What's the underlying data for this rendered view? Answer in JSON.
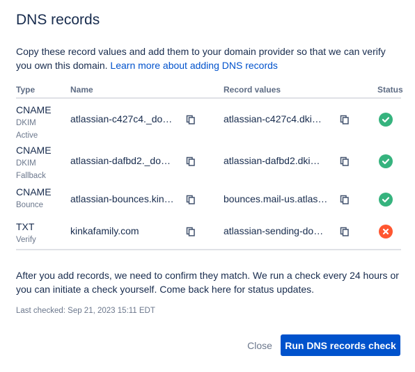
{
  "dialog": {
    "title": "DNS records",
    "intro_text": "Copy these record values and add them to your domain provider so that we can verify you own this domain.",
    "intro_link": "Learn more about adding DNS records"
  },
  "table": {
    "headers": {
      "type": "Type",
      "name": "Name",
      "values": "Record values",
      "status": "Status"
    },
    "rows": [
      {
        "type": "CNAME",
        "sub1": "DKIM",
        "sub2": "Active",
        "name": "atlassian-c427c4._do…",
        "value": "atlassian-c427c4.dki…",
        "status": "ok"
      },
      {
        "type": "CNAME",
        "sub1": "DKIM",
        "sub2": "Fallback",
        "name": "atlassian-dafbd2._do…",
        "value": "atlassian-dafbd2.dki…",
        "status": "ok"
      },
      {
        "type": "CNAME",
        "sub1": "Bounce",
        "sub2": "",
        "name": "atlassian-bounces.kin…",
        "value": "bounces.mail-us.atlas…",
        "status": "ok"
      },
      {
        "type": "TXT",
        "sub1": "Verify",
        "sub2": "",
        "name": "kinkafamily.com",
        "value": "atlassian-sending-do…",
        "status": "error"
      }
    ]
  },
  "footer": {
    "note": "After you add records, we need to confirm they match. We run a check every 24 hours or you can initiate a check yourself. Come back here for status updates.",
    "last_checked": "Last checked: Sep 21, 2023 15:11 EDT",
    "close_label": "Close",
    "run_label": "Run DNS records check"
  },
  "colors": {
    "primary": "#0052CC",
    "success": "#36B37E",
    "danger": "#FF5630",
    "text": "#172B4D",
    "subtle": "#6B778C"
  },
  "icons": {
    "copy": "copy-icon",
    "success": "check-circle-icon",
    "error": "cross-circle-icon"
  }
}
